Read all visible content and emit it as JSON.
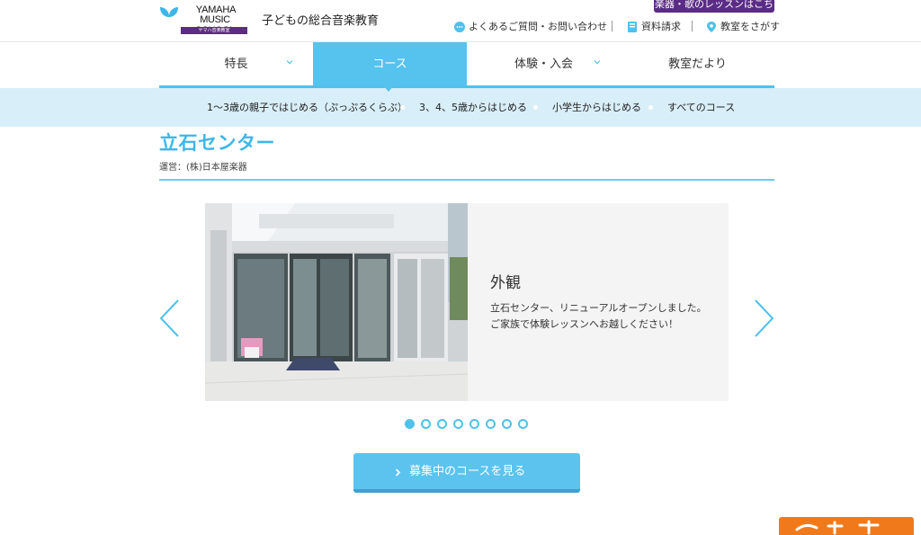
{
  "header": {
    "logo": {
      "line1": "YAMAHA",
      "line2": "MUSIC SCHOOL",
      "badge": "ヤマハ音楽教室"
    },
    "tagline": "子どもの総合音楽教育",
    "top_banner": "楽器・歌のレッスンはこちら",
    "utility_links": [
      {
        "label": "よくあるご質問・お問い合わせ",
        "icon": "chat-icon"
      },
      {
        "label": "資料請求",
        "icon": "book-icon"
      },
      {
        "label": "教室をさがす",
        "icon": "map-pin-icon"
      }
    ]
  },
  "main_nav": [
    {
      "label": "特長",
      "has_dropdown": true,
      "active": false
    },
    {
      "label": "コース",
      "has_dropdown": false,
      "active": true
    },
    {
      "label": "体験・入会",
      "has_dropdown": true,
      "active": false
    },
    {
      "label": "教室だより",
      "has_dropdown": false,
      "active": false
    }
  ],
  "sub_nav": [
    {
      "label": "1〜3歳の親子ではじめる（ぷっぷるくらぶ）"
    },
    {
      "label": "3、4、5歳からはじめる"
    },
    {
      "label": "小学生からはじめる"
    },
    {
      "label": "すべてのコース"
    }
  ],
  "page": {
    "title": "立石センター",
    "operator": "運営：(株)日本屋楽器"
  },
  "slider": {
    "heading": "外観",
    "text_line1": "立石センター、リニューアルオープンしました。",
    "text_line2": "ご家族で体験レッスンへお越しください！",
    "current_slide": 1,
    "total_slides": 8
  },
  "cta": {
    "label": "募集中のコースを見る"
  },
  "colors": {
    "accent": "#56c2ee",
    "brand_purple": "#5b2c86",
    "subnav_bg": "#d8eef8",
    "promo_orange": "#f07a1b"
  }
}
